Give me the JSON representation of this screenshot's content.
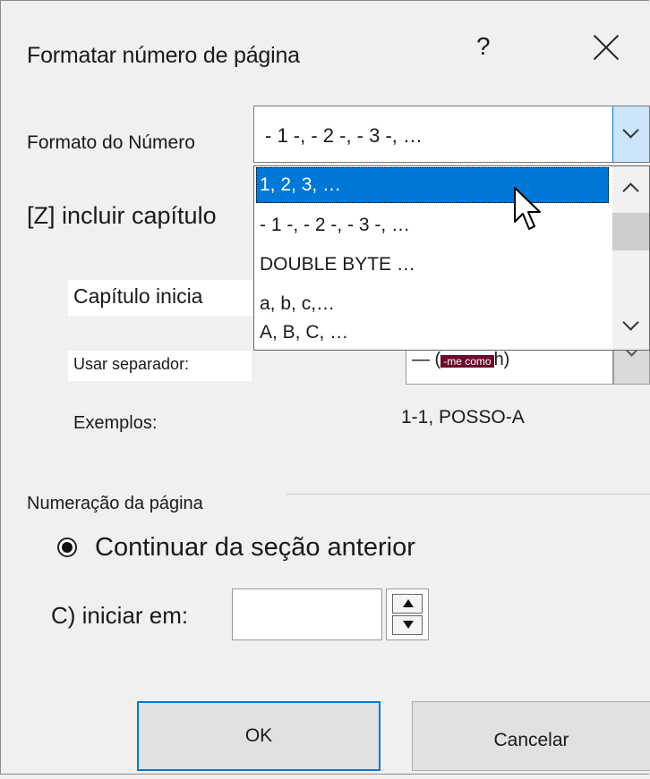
{
  "dialog": {
    "title": "Formatar número de página",
    "help_glyph": "?"
  },
  "number_format": {
    "label": "Formato do Número",
    "selected_value": "- 1 -, - 2 -, - 3 -, …",
    "options": [
      "1, 2, 3, …",
      "- 1 -, - 2 -, - 3 -, …",
      "DOUBLE BYTE …",
      "a, b, c,…",
      "A, B, C, …"
    ],
    "highlighted_index": 0
  },
  "include_chapter": {
    "label": "[Z] incluir capítulo"
  },
  "chapter_starts": {
    "label": "Capítulo inicia"
  },
  "separator": {
    "label": "Usar separador:",
    "value_prefix": "— (",
    "badge": "-me como",
    "value_suffix": "h)"
  },
  "examples": {
    "label": "Exemplos:",
    "value": "1-1,  POSSO-A"
  },
  "page_numbering": {
    "group_label": "Numeração da página",
    "continue_label": "Continuar da seção anterior",
    "continue_selected": true,
    "start_at_label": "C) iniciar em:",
    "start_at_value": ""
  },
  "buttons": {
    "ok": "OK",
    "cancel": "Cancelar"
  },
  "icons": {
    "close": "close-icon",
    "dropdown": "chevron-down-icon",
    "cursor": "mouse-pointer-icon"
  }
}
